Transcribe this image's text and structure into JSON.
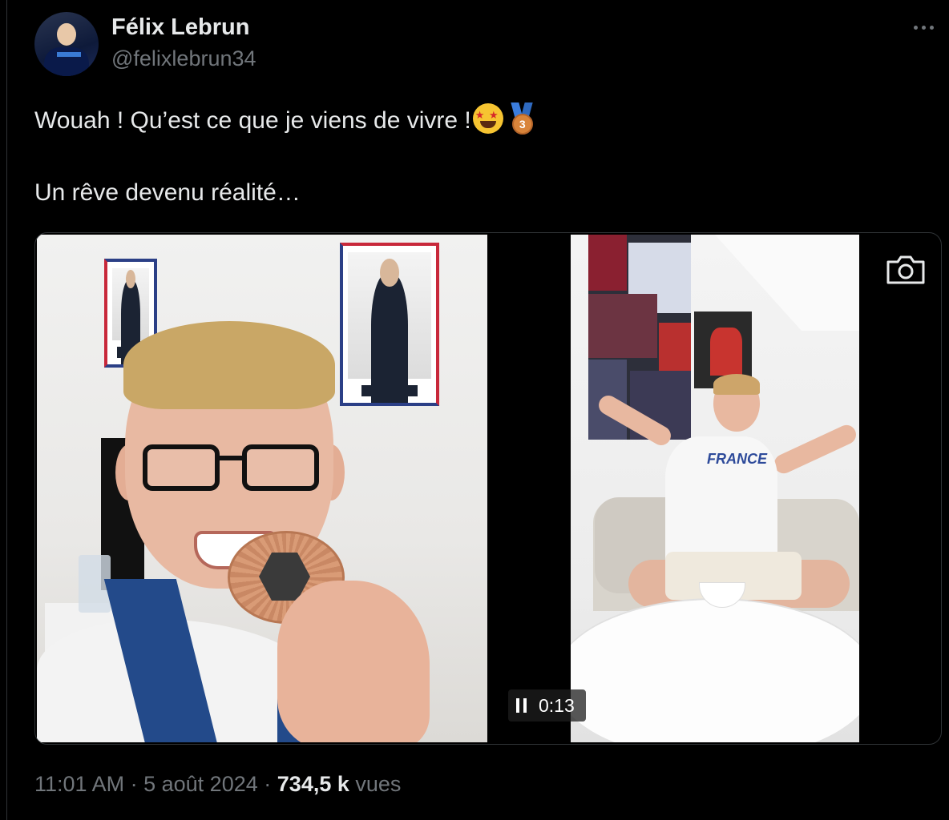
{
  "author": {
    "name": "Félix Lebrun",
    "handle": "@felixlebrun34",
    "avatar_icon": "avatar-photo"
  },
  "tweet": {
    "line1": "Wouah ! Qu’est ce que je viens de vivre !",
    "line1_emojis": [
      "star-struck-emoji",
      "bronze-medal-emoji"
    ],
    "medal_digit": "3",
    "line2": "Un rêve devenu réalité…"
  },
  "media": {
    "camera_icon": "camera-icon",
    "pause_icon": "pause-icon",
    "timer": "0:13",
    "right_shirt_text": "FRANCE"
  },
  "meta": {
    "time": "11:01 AM",
    "separator": "·",
    "date": "5 août 2024",
    "views_count": "734,5 k",
    "views_label": "vues"
  },
  "colors": {
    "background": "#000000",
    "text_primary": "#e7e9ea",
    "text_secondary": "#71767b",
    "border": "#2f3336"
  }
}
